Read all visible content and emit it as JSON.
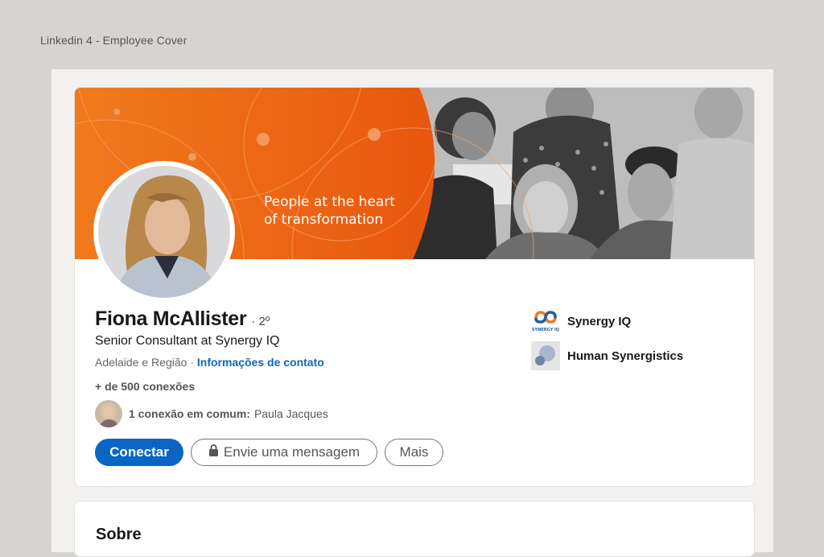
{
  "artboard": {
    "label": "Linkedin 4 - Employee Cover"
  },
  "cover": {
    "tagline_line1": "People at the heart",
    "tagline_line2": "of transformation",
    "accent_color": "#e8570f"
  },
  "profile": {
    "name": "Fiona McAllister",
    "degree": "· 2º",
    "headline": "Senior Consultant at Synergy IQ",
    "location": "Adelaide e Região",
    "separator": "·",
    "contact_link": "Informações de contato",
    "connections": "+ de 500 conexões",
    "mutual_count": "1 conexão em comum:",
    "mutual_name": "Paula Jacques"
  },
  "actions": {
    "connect": "Conectar",
    "message": "Envie uma mensagem",
    "more": "Mais",
    "primary_color": "#0a66c2"
  },
  "companies": [
    {
      "name": "Synergy IQ",
      "logo_text": "SYNERGY IQ"
    },
    {
      "name": "Human Synergistics"
    }
  ],
  "about": {
    "title": "Sobre"
  }
}
